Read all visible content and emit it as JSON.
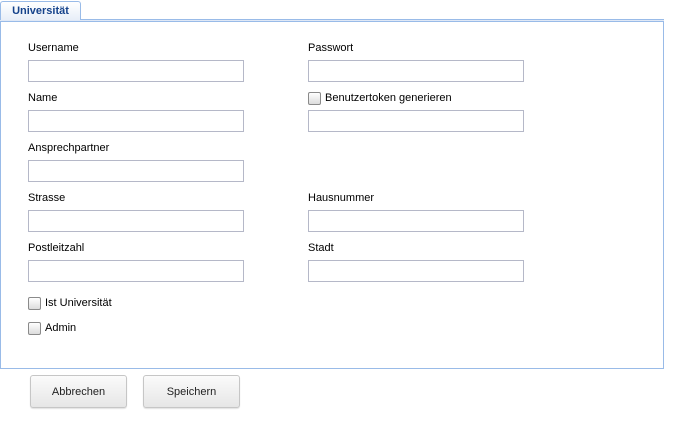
{
  "tab": {
    "label": "Universität"
  },
  "form": {
    "username": {
      "label": "Username",
      "value": ""
    },
    "passwort": {
      "label": "Passwort",
      "value": ""
    },
    "name": {
      "label": "Name",
      "value": ""
    },
    "benutzertoken": {
      "label": "Benutzertoken generieren",
      "checked": false,
      "value": ""
    },
    "ansprechpartner": {
      "label": "Ansprechpartner",
      "value": ""
    },
    "strasse": {
      "label": "Strasse",
      "value": ""
    },
    "hausnummer": {
      "label": "Hausnummer",
      "value": ""
    },
    "postleitzahl": {
      "label": "Postleitzahl",
      "value": ""
    },
    "stadt": {
      "label": "Stadt",
      "value": ""
    },
    "ist_universitaet": {
      "label": "Ist Universität",
      "checked": false
    },
    "admin": {
      "label": "Admin",
      "checked": false
    }
  },
  "buttons": {
    "cancel": "Abbrechen",
    "save": "Speichern"
  },
  "colors": {
    "accent_border": "#99bbe8",
    "tab_text": "#15428b"
  }
}
